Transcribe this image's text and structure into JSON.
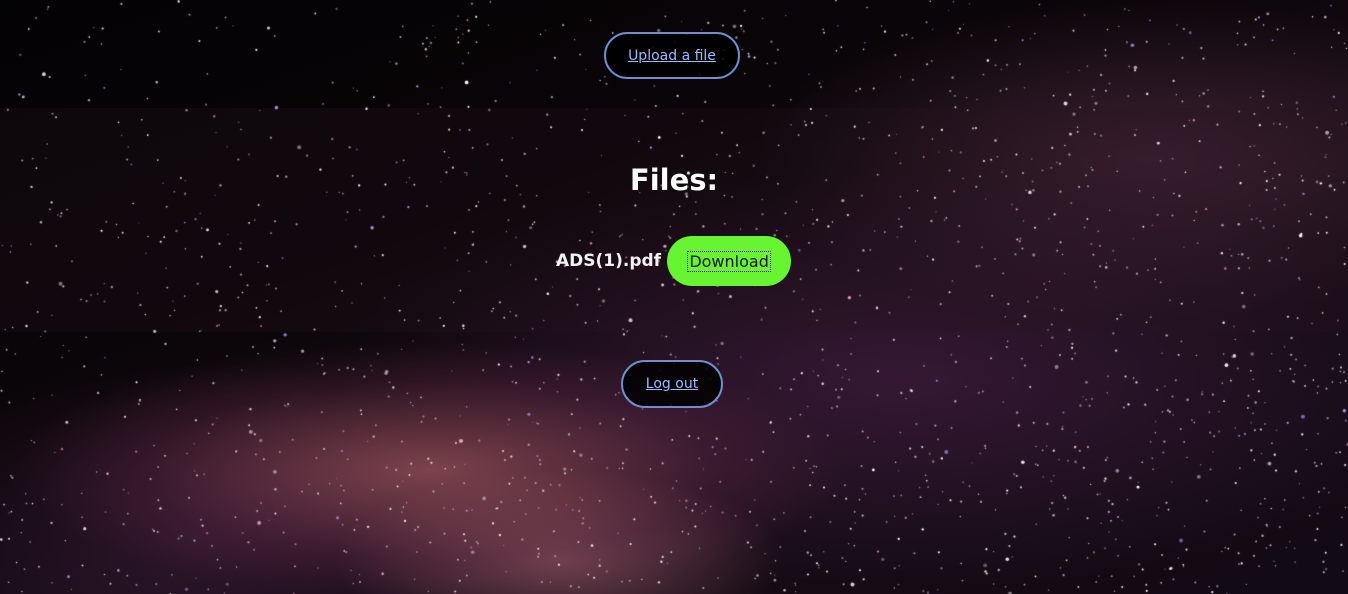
{
  "actions": {
    "upload_label": "Upload a file",
    "logout_label": "Log out"
  },
  "files": {
    "heading": "Files:",
    "items": [
      {
        "name": "ADS(1).pdf",
        "download_label": "Download"
      }
    ]
  },
  "colors": {
    "link_border": "#6f8fd0",
    "link_text": "#9db8ff",
    "download_bg": "#67f532",
    "page_bg": "#040205"
  }
}
